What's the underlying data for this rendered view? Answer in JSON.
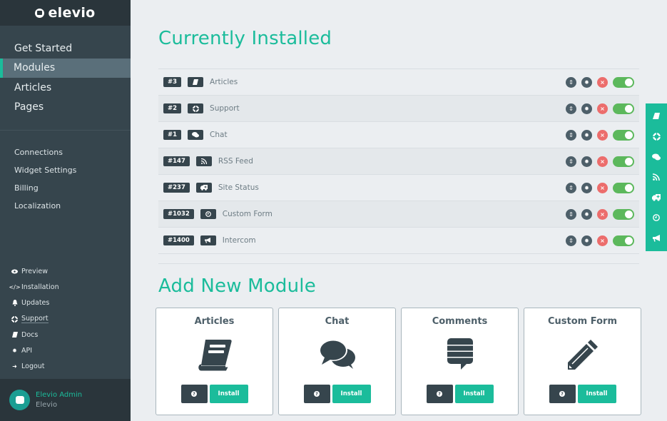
{
  "brand": {
    "name": "elevio"
  },
  "sidebar": {
    "main_items": [
      {
        "label": "Get Started",
        "active": false
      },
      {
        "label": "Modules",
        "active": true
      },
      {
        "label": "Articles",
        "active": false
      },
      {
        "label": "Pages",
        "active": false
      }
    ],
    "sub_items": [
      {
        "label": "Connections"
      },
      {
        "label": "Widget Settings"
      },
      {
        "label": "Billing"
      },
      {
        "label": "Localization"
      }
    ],
    "bottom_items": [
      {
        "label": "Preview",
        "icon": "eye-icon"
      },
      {
        "label": "Installation",
        "icon": "code-icon"
      },
      {
        "label": "Updates",
        "icon": "bell-icon"
      },
      {
        "label": "Support",
        "icon": "lifebuoy-icon"
      },
      {
        "label": "Docs",
        "icon": "book-icon"
      },
      {
        "label": "API",
        "icon": "gear-icon"
      },
      {
        "label": "Logout",
        "icon": "logout-icon"
      }
    ],
    "user": {
      "name": "Elevio Admin",
      "org": "Elevio"
    }
  },
  "installed": {
    "title": "Currently Installed",
    "modules": [
      {
        "id": "#3",
        "name": "Articles",
        "icon": "book-icon",
        "enabled": true
      },
      {
        "id": "#2",
        "name": "Support",
        "icon": "lifebuoy-icon",
        "enabled": true
      },
      {
        "id": "#1",
        "name": "Chat",
        "icon": "comments-icon",
        "enabled": true
      },
      {
        "id": "#147",
        "name": "RSS Feed",
        "icon": "rss-icon",
        "enabled": true
      },
      {
        "id": "#237",
        "name": "Site Status",
        "icon": "ambulance-icon",
        "enabled": true
      },
      {
        "id": "#1032",
        "name": "Custom Form",
        "icon": "clock-icon",
        "enabled": true
      },
      {
        "id": "#1400",
        "name": "Intercom",
        "icon": "bullhorn-icon",
        "enabled": true
      }
    ]
  },
  "add_new": {
    "title": "Add New Module",
    "help_label": "?",
    "install_label": "Install",
    "cards": [
      {
        "title": "Articles",
        "icon": "book-icon"
      },
      {
        "title": "Chat",
        "icon": "comments-icon"
      },
      {
        "title": "Comments",
        "icon": "comment-lines-icon"
      },
      {
        "title": "Custom Form",
        "icon": "pencil-icon"
      }
    ]
  },
  "launcher": {
    "icons": [
      "book-icon",
      "lifebuoy-icon",
      "comments-icon",
      "rss-icon",
      "ambulance-icon",
      "clock-icon",
      "bullhorn-icon"
    ]
  },
  "colors": {
    "accent": "#1bbc9b",
    "sidebar": "#36454d",
    "danger": "#ec6d6c",
    "toggle_on": "#5cb85c"
  }
}
